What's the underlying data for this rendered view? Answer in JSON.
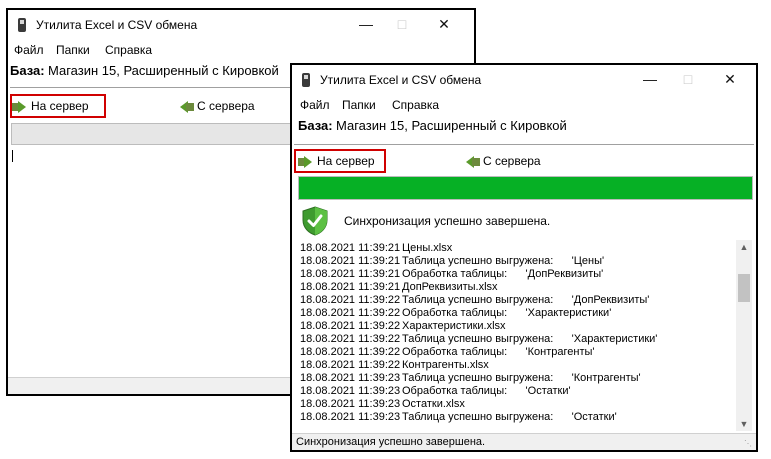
{
  "colors": {
    "accent": "#d00000",
    "progress": "#06b025"
  },
  "back_window": {
    "title": "Утилита Excel и CSV обмена",
    "menu": [
      "Файл",
      "Папки",
      "Справка"
    ],
    "db_label": "База:",
    "db_value": "Магазин 15, Расширенный с Кировкой",
    "to_server_label": "На сервер",
    "from_server_label": "С сервера",
    "progress": 0
  },
  "front_window": {
    "title": "Утилита Excel и CSV обмена",
    "menu": [
      "Файл",
      "Папки",
      "Справка"
    ],
    "db_label": "База:",
    "db_value": "Магазин 15, Расширенный с Кировкой",
    "to_server_label": "На сервер",
    "from_server_label": "С сервера",
    "progress": 1.0,
    "status_icon": "shield-check-icon",
    "status_message": "Синхронизация успешно завершена.",
    "log": [
      {
        "ts": "18.08.2021 11:39:21",
        "msg": "Цены.xlsx"
      },
      {
        "ts": "18.08.2021 11:39:21",
        "msg": "Таблица успешно выгружена:      'Цены'"
      },
      {
        "ts": "18.08.2021 11:39:21",
        "msg": "Обработка таблицы:      'ДопРеквизиты'"
      },
      {
        "ts": "18.08.2021 11:39:21",
        "msg": "ДопРеквизиты.xlsx"
      },
      {
        "ts": "18.08.2021 11:39:22",
        "msg": "Таблица успешно выгружена:      'ДопРеквизиты'"
      },
      {
        "ts": "18.08.2021 11:39:22",
        "msg": "Обработка таблицы:      'Характеристики'"
      },
      {
        "ts": "18.08.2021 11:39:22",
        "msg": "Характеристики.xlsx"
      },
      {
        "ts": "18.08.2021 11:39:22",
        "msg": "Таблица успешно выгружена:      'Характеристики'"
      },
      {
        "ts": "18.08.2021 11:39:22",
        "msg": "Обработка таблицы:      'Контрагенты'"
      },
      {
        "ts": "18.08.2021 11:39:22",
        "msg": "Контрагенты.xlsx"
      },
      {
        "ts": "18.08.2021 11:39:23",
        "msg": "Таблица успешно выгружена:      'Контрагенты'"
      },
      {
        "ts": "18.08.2021 11:39:23",
        "msg": "Обработка таблицы:      'Остатки'"
      },
      {
        "ts": "18.08.2021 11:39:23",
        "msg": "Остатки.xlsx"
      },
      {
        "ts": "18.08.2021 11:39:23",
        "msg": "Таблица успешно выгружена:      'Остатки'"
      }
    ],
    "statusbar_text": "Синхронизация успешно завершена."
  }
}
